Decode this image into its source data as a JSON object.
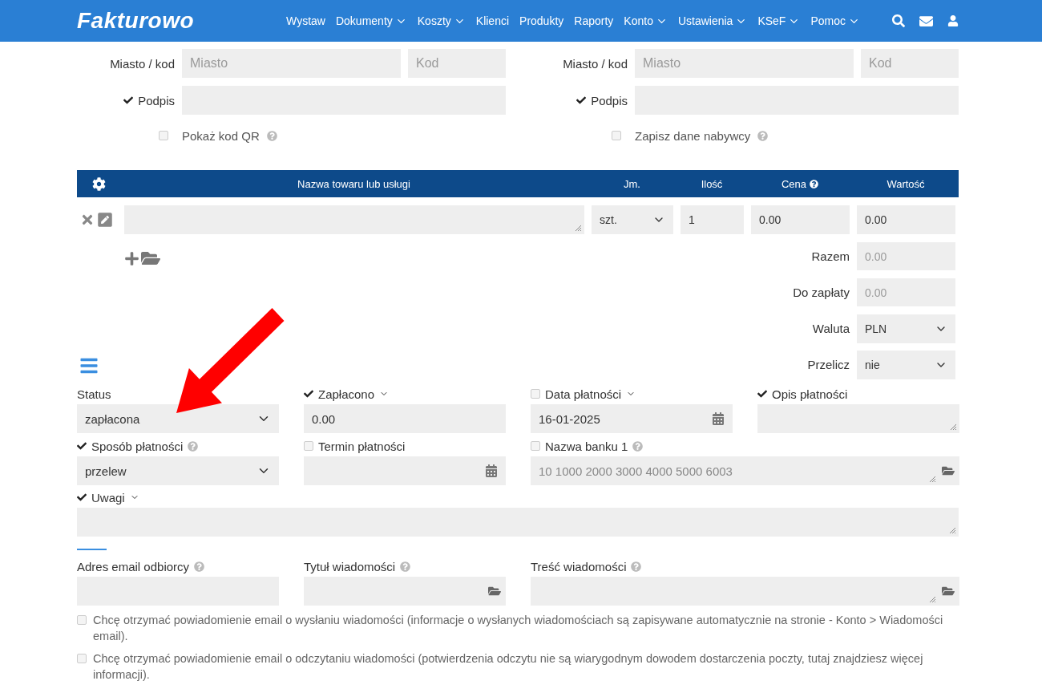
{
  "nav": {
    "logo": "Fakturowo",
    "items": [
      {
        "label": "Wystaw",
        "dropdown": false
      },
      {
        "label": "Dokumenty",
        "dropdown": true
      },
      {
        "label": "Koszty",
        "dropdown": true
      },
      {
        "label": "Klienci",
        "dropdown": false
      },
      {
        "label": "Produkty",
        "dropdown": false
      },
      {
        "label": "Raporty",
        "dropdown": false
      },
      {
        "label": "Konto",
        "dropdown": true
      },
      {
        "label": "Ustawienia",
        "dropdown": true
      },
      {
        "label": "KSeF",
        "dropdown": true
      },
      {
        "label": "Pomoc",
        "dropdown": true
      }
    ]
  },
  "parties": [
    {
      "city_label": "Miasto / kod",
      "city_placeholder": "Miasto",
      "code_placeholder": "Kod",
      "signature_label": "Podpis",
      "signature_checked": true,
      "option": {
        "label": "Pokaż kod QR",
        "checked": false
      }
    },
    {
      "city_label": "Miasto / kod",
      "city_placeholder": "Miasto",
      "code_placeholder": "Kod",
      "signature_label": "Podpis",
      "signature_checked": true,
      "option": {
        "label": "Zapisz dane nabywcy",
        "checked": false
      }
    }
  ],
  "items_table": {
    "columns": [
      {
        "label": "Nazwa towaru lub usługi",
        "help": false
      },
      {
        "label": "Jm.",
        "help": false
      },
      {
        "label": "Ilość",
        "help": false
      },
      {
        "label": "Cena",
        "help": true
      },
      {
        "label": "Wartość",
        "help": false
      }
    ],
    "rows": [
      {
        "unit": "szt.",
        "quantity": "1",
        "price": "0.00",
        "value": "0.00"
      }
    ]
  },
  "totals": [
    {
      "kind": "readonly",
      "label": "Razem",
      "placeholder": "0.00"
    },
    {
      "kind": "readonly",
      "label": "Do zapłaty",
      "placeholder": "0.00"
    },
    {
      "kind": "select",
      "label": "Waluta",
      "value": "PLN"
    },
    {
      "kind": "select",
      "label": "Przelicz",
      "value": "nie"
    }
  ],
  "payment": [
    {
      "kind": "select",
      "label": "Status",
      "value": "zapłacona"
    },
    {
      "kind": "input",
      "label": "Zapłacono",
      "checked": true,
      "caret": true,
      "value": "0.00"
    },
    {
      "kind": "date",
      "label": "Data płatności",
      "checked": false,
      "caret": true,
      "value": "16-01-2025"
    },
    {
      "kind": "textarea",
      "label": "Opis płatności",
      "checked": true
    },
    {
      "kind": "select",
      "label": "Sposób płatności",
      "checked": true,
      "help": true,
      "value": "przelew"
    },
    {
      "kind": "date",
      "label": "Termin płatności",
      "checked": false
    },
    {
      "kind": "account",
      "label": "Nazwa banku 1",
      "checked": false,
      "help": true,
      "value": "10 1000 2000 3000 4000 5000 6003"
    }
  ],
  "remarks": {
    "label": "Uwagi",
    "checked": true,
    "caret": true
  },
  "email": [
    {
      "kind": "input",
      "label": "Adres email odbiorcy",
      "help": true
    },
    {
      "kind": "folder-input",
      "label": "Tytuł wiadomości",
      "help": true
    },
    {
      "kind": "folder-textarea",
      "label": "Treść wiadomości",
      "help": true
    }
  ],
  "notifications": [
    {
      "text": "Chcę otrzymać powiadomienie email o wysłaniu wiadomości (informacje o wysłanych wiadomościach są zapisywane automatycznie na stronie - Konto > Wiadomości email).",
      "checked": false
    },
    {
      "text": "Chcę otrzymać powiadomienie email o odczytaniu wiadomości (potwierdzenia odczytu nie są wiarygodnym dowodem dostarczenia poczty, tutaj znajdziesz więcej informacji).",
      "checked": false
    }
  ]
}
